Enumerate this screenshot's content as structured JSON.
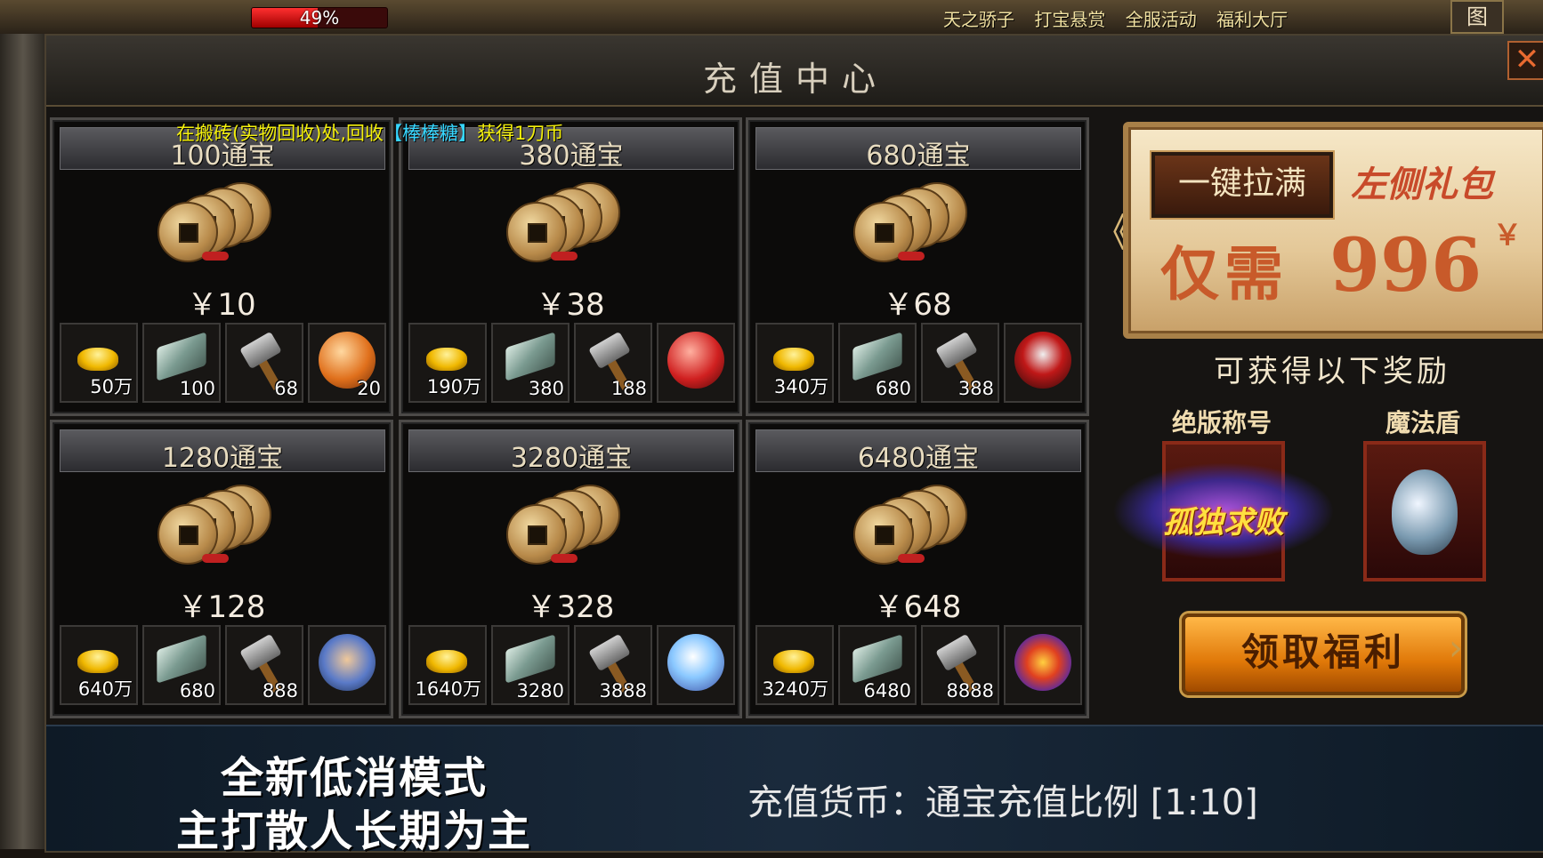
{
  "hud": {
    "hp_percent": 49,
    "hp_label": "49%",
    "menu": [
      "天之骄子",
      "打宝悬赏",
      "全服活动",
      "福利大厅"
    ],
    "map_label": "图"
  },
  "panel": {
    "title": "充值中心",
    "close": "✕",
    "notice_before": "在搬砖(实物回收)处,回收",
    "notice_item": "【棒棒糖】",
    "notice_after": "获得1刀币"
  },
  "packages": [
    {
      "name": "100通宝",
      "price": "￥10",
      "items": [
        {
          "icon": "gold-ingot",
          "count": "50万"
        },
        {
          "icon": "scroll",
          "count": "100"
        },
        {
          "icon": "hammer",
          "count": "68"
        },
        {
          "icon": "orange-orb",
          "count": "20"
        }
      ]
    },
    {
      "name": "380通宝",
      "price": "￥38",
      "items": [
        {
          "icon": "gold-ingot",
          "count": "190万"
        },
        {
          "icon": "scroll",
          "count": "380"
        },
        {
          "icon": "hammer",
          "count": "188"
        },
        {
          "icon": "red-orb",
          "count": ""
        }
      ]
    },
    {
      "name": "680通宝",
      "price": "￥68",
      "items": [
        {
          "icon": "gold-ingot",
          "count": "340万"
        },
        {
          "icon": "scroll",
          "count": "680"
        },
        {
          "icon": "hammer",
          "count": "388"
        },
        {
          "icon": "red-emblem",
          "count": ""
        }
      ]
    },
    {
      "name": "1280通宝",
      "price": "￥128",
      "items": [
        {
          "icon": "gold-ingot",
          "count": "640万"
        },
        {
          "icon": "scroll",
          "count": "680"
        },
        {
          "icon": "hammer",
          "count": "888"
        },
        {
          "icon": "praying-hands",
          "count": ""
        }
      ]
    },
    {
      "name": "3280通宝",
      "price": "￥328",
      "items": [
        {
          "icon": "gold-ingot",
          "count": "1640万"
        },
        {
          "icon": "scroll",
          "count": "3280"
        },
        {
          "icon": "hammer",
          "count": "3888"
        },
        {
          "icon": "crystal-orb",
          "count": ""
        }
      ]
    },
    {
      "name": "6480通宝",
      "price": "￥648",
      "items": [
        {
          "icon": "gold-ingot",
          "count": "3240万"
        },
        {
          "icon": "scroll",
          "count": "6480"
        },
        {
          "icon": "hammer",
          "count": "8888"
        },
        {
          "icon": "winged-emblem",
          "count": ""
        }
      ]
    }
  ],
  "gift": {
    "fill_button": "一键拉满",
    "left_gift_label": "左侧礼包",
    "only_need": "仅需",
    "price": "996",
    "currency": "￥",
    "arrow": "《",
    "reward_title": "可获得以下奖励",
    "rewards": [
      {
        "label": "绝版称号",
        "title_text": "孤独求败"
      },
      {
        "label": "魔法盾"
      }
    ],
    "claim_button": "领取福利"
  },
  "bottom": {
    "slogan_line1": "全新低消模式",
    "slogan_line2": "主打散人长期为主",
    "ratio": "充值货币：通宝充值比例 [1:10]"
  },
  "colors": {
    "notice_text": "#f4f00c",
    "notice_highlight": "#36d6ff",
    "claim_button": "#e07808",
    "gift_accent": "#c85a2a"
  }
}
